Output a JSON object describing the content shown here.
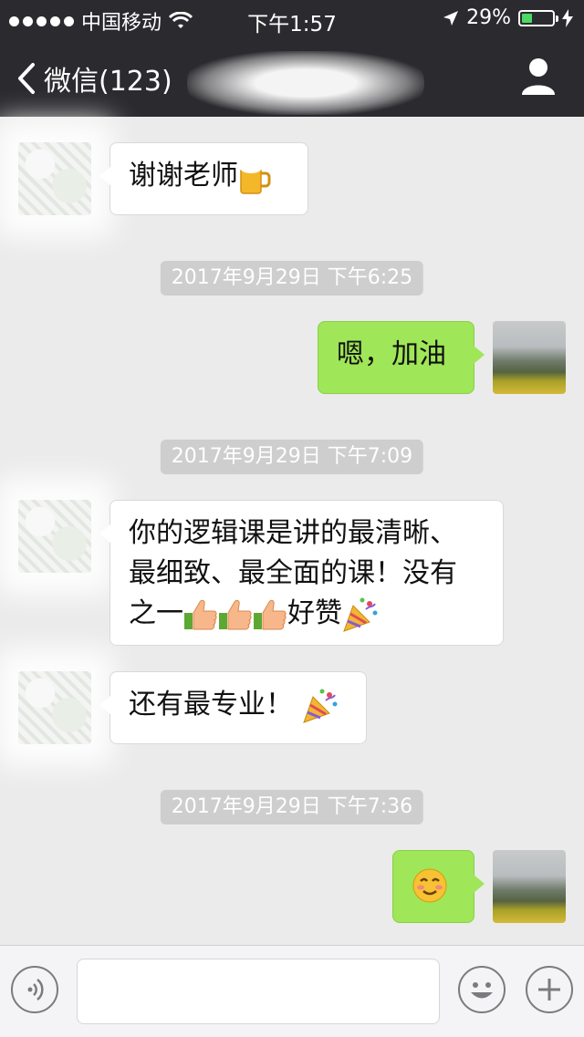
{
  "status_bar": {
    "carrier": "中国移动",
    "time": "下午1:57",
    "battery": "29%"
  },
  "nav": {
    "back_label": "微信(123)"
  },
  "messages": [
    {
      "text": "谢谢老师"
    },
    {
      "timestamp": "2017年9月29日 下午6:25"
    },
    {
      "text": "嗯，加油"
    },
    {
      "timestamp": "2017年9月29日 下午7:09"
    },
    {
      "lines": [
        "你的逻辑课是讲的最清晰、",
        "最细致、最全面的课！没有",
        "之一",
        "好赞"
      ]
    },
    {
      "text": "还有最专业！"
    },
    {
      "timestamp": "2017年9月29日 下午7:36"
    }
  ],
  "icons": {
    "back": "chevron-left-icon",
    "profile": "person-icon",
    "voice": "voice-icon",
    "emoji": "smiley-icon",
    "add": "plus-icon"
  },
  "colors": {
    "header_bg": "#2b2b2f",
    "chat_bg": "#ebebeb",
    "my_bubble": "#9fe658",
    "their_bubble": "#ffffff",
    "timestamp_bg": "#cecece"
  }
}
